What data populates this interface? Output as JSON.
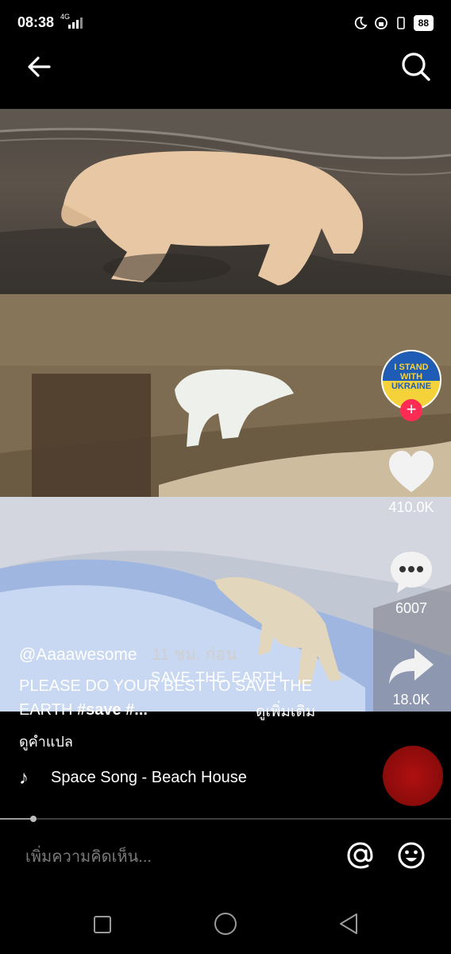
{
  "status_bar": {
    "time": "08:38",
    "network": "4G",
    "battery": "88"
  },
  "header": {
    "back_icon": "arrow-left-icon",
    "search_icon": "search-icon"
  },
  "video": {
    "subtitle": "SAVE THE EARTH",
    "avatar_text_line1": "I STAND",
    "avatar_text_line2": "WITH",
    "avatar_text_line3": "UKRAINE",
    "follow_symbol": "+"
  },
  "actions": {
    "likes": "410.0K",
    "comments": "6007",
    "shares": "18.0K"
  },
  "post": {
    "author": "@Aaaawesome",
    "time_ago": "· 11 ชม. ก่อน",
    "caption_text": "PLEASE DO YOUR BEST TO SAVE THE EARTH ",
    "caption_tag": "#save #...",
    "see_more": "ดูเพิ่มเติม",
    "translate": "ดูคำแปล",
    "music": "Space Song - Beach House"
  },
  "playback": {
    "progress": 0.074
  },
  "comment_bar": {
    "placeholder": "เพิ่มความคิดเห็น...",
    "mention_icon": "at-sign-icon",
    "emoji_icon": "emoji-icon"
  },
  "colors": {
    "accent": "#fe2c55",
    "background": "#000000"
  }
}
